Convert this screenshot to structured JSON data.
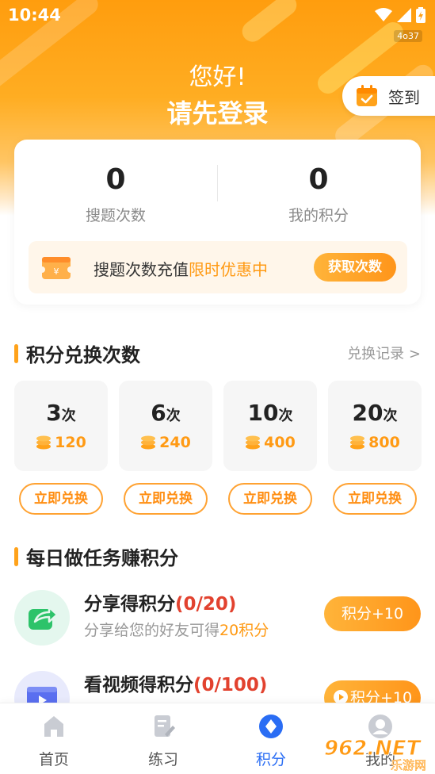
{
  "status_bar": {
    "time": "10:44",
    "tag": "4o37"
  },
  "header": {
    "greeting": "您好!",
    "login_prompt": "请先登录",
    "signin_label": "签到"
  },
  "stats": [
    {
      "value": "0",
      "caption": "搜题次数"
    },
    {
      "value": "0",
      "caption": "我的积分"
    }
  ],
  "promo": {
    "text_prefix": "搜题次数充值",
    "text_highlight": "限时优惠中",
    "button_label": "获取次数"
  },
  "exchange": {
    "title": "积分兑换次数",
    "records_link": "兑换记录 >",
    "packages": [
      {
        "count": "3",
        "unit": "次",
        "cost": "120",
        "button_label": "立即兑换"
      },
      {
        "count": "6",
        "unit": "次",
        "cost": "240",
        "button_label": "立即兑换"
      },
      {
        "count": "10",
        "unit": "次",
        "cost": "400",
        "button_label": "立即兑换"
      },
      {
        "count": "20",
        "unit": "次",
        "cost": "800",
        "button_label": "立即兑换"
      }
    ]
  },
  "tasks": {
    "title": "每日做任务赚积分",
    "items": [
      {
        "name": "分享得积分",
        "progress": "(0/20)",
        "desc_prefix": "分享给您的好友可得",
        "desc_highlight": "20积分",
        "button_label": "积分+10"
      },
      {
        "name": "看视频得积分",
        "progress": "(0/100)",
        "button_label": "积分+10"
      }
    ]
  },
  "tabbar": {
    "items": [
      {
        "label": "首页"
      },
      {
        "label": "练习"
      },
      {
        "label": "积分"
      },
      {
        "label": "我的"
      }
    ]
  },
  "watermark": {
    "brand": "962.NET",
    "sub": "乐游网"
  },
  "colors": {
    "accent": "#ff9a14",
    "active_tab": "#2a6df4",
    "progress_red": "#e2422f"
  }
}
